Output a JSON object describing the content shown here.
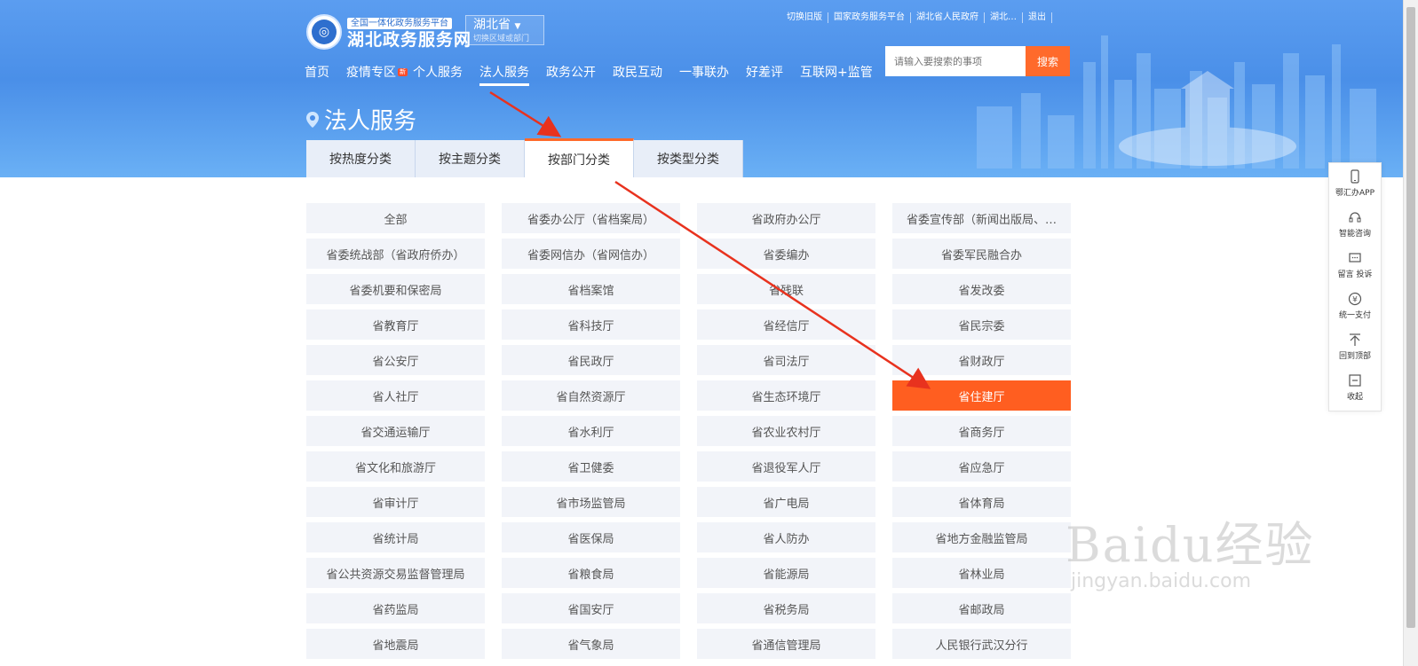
{
  "header": {
    "logo_sub": "全国一体化政务服务平台",
    "logo_main": "湖北政务服务网",
    "region_name": "湖北省",
    "region_hint": "切换区域或部门",
    "top_links": [
      "切换旧版",
      "国家政务服务平台",
      "湖北省人民政府",
      "湖北…",
      "退出"
    ],
    "search_placeholder": "请输入要搜索的事项",
    "search_button": "搜索",
    "nav": [
      "首页",
      "疫情专区",
      "个人服务",
      "法人服务",
      "政务公开",
      "政民互动",
      "一事联办",
      "好差评",
      "互联网+监管"
    ],
    "nav_badge": "新"
  },
  "page_title": "法人服务",
  "tabs": [
    "按热度分类",
    "按主题分类",
    "按部门分类",
    "按类型分类"
  ],
  "departments": [
    "全部",
    "省委办公厅（省档案局）",
    "省政府办公厅",
    "省委宣传部（新闻出版局、…",
    "省委统战部（省政府侨办）",
    "省委网信办（省网信办）",
    "省委编办",
    "省委军民融合办",
    "省委机要和保密局",
    "省档案馆",
    "省残联",
    "省发改委",
    "省教育厅",
    "省科技厅",
    "省经信厅",
    "省民宗委",
    "省公安厅",
    "省民政厅",
    "省司法厅",
    "省财政厅",
    "省人社厅",
    "省自然资源厅",
    "省生态环境厅",
    "省住建厅",
    "省交通运输厅",
    "省水利厅",
    "省农业农村厅",
    "省商务厅",
    "省文化和旅游厅",
    "省卫健委",
    "省退役军人厅",
    "省应急厅",
    "省审计厅",
    "省市场监管局",
    "省广电局",
    "省体育局",
    "省统计局",
    "省医保局",
    "省人防办",
    "省地方金融监管局",
    "省公共资源交易监督管理局",
    "省粮食局",
    "省能源局",
    "省林业局",
    "省药监局",
    "省国安厅",
    "省税务局",
    "省邮政局",
    "省地震局",
    "省气象局",
    "省通信管理局",
    "人民银行武汉分行"
  ],
  "toolbar": [
    {
      "label": "鄂汇办APP",
      "icon": "phone-icon"
    },
    {
      "label": "智能咨询",
      "icon": "headset-icon"
    },
    {
      "label": "留言 投诉",
      "icon": "message-icon"
    },
    {
      "label": "统一支付",
      "icon": "yuan-icon"
    },
    {
      "label": "回到顶部",
      "icon": "back-to-top-icon"
    },
    {
      "label": "收起",
      "icon": "collapse-icon"
    }
  ],
  "watermark": {
    "main": "Baidu经验",
    "sub": "jingyan.baidu.com"
  },
  "colors": {
    "accent": "#ff5e20",
    "header_blue": "#4a8fe8"
  }
}
